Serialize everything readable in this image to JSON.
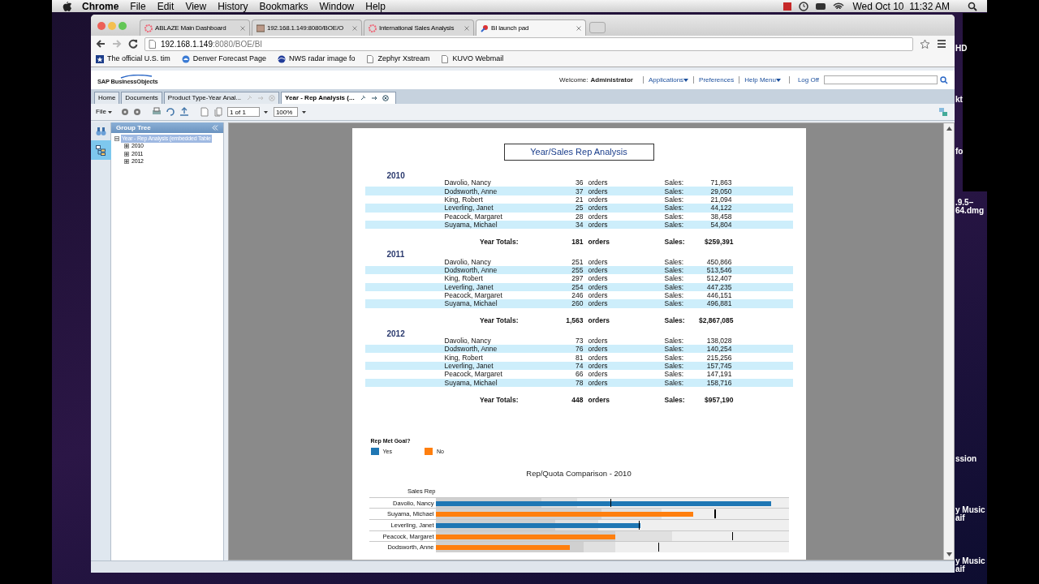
{
  "menu_bar": {
    "app": "Chrome",
    "menus": [
      "File",
      "Edit",
      "View",
      "History",
      "Bookmarks",
      "Window",
      "Help"
    ],
    "clock": "Wed Oct 10  11:32 AM"
  },
  "desktop_labels": [
    "HD",
    "kt",
    "fo",
    ".9.5–",
    "64.dmg",
    "ssion",
    "y Music",
    "aif",
    "y Music",
    "aif"
  ],
  "browser": {
    "tabs": [
      {
        "title": "ABLAZE Main Dashboard",
        "selected": false
      },
      {
        "title": "192.168.1.149:8080/BOE/O",
        "selected": false
      },
      {
        "title": "International Sales Analysis",
        "selected": false
      },
      {
        "title": "BI launch pad",
        "selected": true
      }
    ],
    "url_host": "192.168.1.149",
    "url_path": ":8080/BOE/BI",
    "bookmarks": [
      "The official U.S. tim",
      "Denver Forecast Page",
      "NWS radar image fo",
      "Zephyr Xstream",
      "KUVO Webmail"
    ]
  },
  "app": {
    "logo": "SAP BusinessObjects",
    "welcome_label": "Welcome:",
    "user": "Administrator",
    "header_links": [
      {
        "label": "Applications",
        "dropdown": true
      },
      {
        "label": "Preferences",
        "dropdown": false
      },
      {
        "label": "Help Menu",
        "dropdown": true
      },
      {
        "label": "Log Off",
        "dropdown": false
      }
    ],
    "doc_tabs": [
      {
        "label": "Home",
        "selected": false
      },
      {
        "label": "Documents",
        "selected": false
      },
      {
        "label": "Product Type-Year Anal...",
        "selected": false
      },
      {
        "label": "Year - Rep Analysis (...",
        "selected": true
      }
    ],
    "toolbar": {
      "file_menu": "File",
      "page": "1 of 1",
      "zoom": "100%"
    },
    "group_tree": {
      "title": "Group Tree",
      "items": [
        {
          "label": "Year - Rep Analysis (embedded Table",
          "selected": true,
          "expanded": true,
          "children": [
            {
              "label": "2010",
              "selected": false,
              "expanded": false
            },
            {
              "label": "2011",
              "selected": false,
              "expanded": false
            },
            {
              "label": "2012",
              "selected": false,
              "expanded": false
            }
          ]
        }
      ]
    }
  },
  "report": {
    "title": "Year/Sales Rep Analysis",
    "years": [
      {
        "year": "2010",
        "rows": [
          {
            "rep": "Davolio, Nancy",
            "orders": "36",
            "unit": "orders",
            "sales_label": "Sales:",
            "sales": "71,863"
          },
          {
            "rep": "Dodsworth, Anne",
            "orders": "37",
            "unit": "orders",
            "sales_label": "Sales:",
            "sales": "29,050"
          },
          {
            "rep": "King, Robert",
            "orders": "21",
            "unit": "orders",
            "sales_label": "Sales:",
            "sales": "21,094"
          },
          {
            "rep": "Leverling, Janet",
            "orders": "25",
            "unit": "orders",
            "sales_label": "Sales:",
            "sales": "44,122"
          },
          {
            "rep": "Peacock, Margaret",
            "orders": "28",
            "unit": "orders",
            "sales_label": "Sales:",
            "sales": "38,458"
          },
          {
            "rep": "Suyama, Michael",
            "orders": "34",
            "unit": "orders",
            "sales_label": "Sales:",
            "sales": "54,804"
          }
        ],
        "totals": {
          "label": "Year Totals:",
          "orders": "181",
          "unit": "orders",
          "sales_label": "Sales:",
          "sales": "$259,391"
        }
      },
      {
        "year": "2011",
        "rows": [
          {
            "rep": "Davolio, Nancy",
            "orders": "251",
            "unit": "orders",
            "sales_label": "Sales:",
            "sales": "450,866"
          },
          {
            "rep": "Dodsworth, Anne",
            "orders": "255",
            "unit": "orders",
            "sales_label": "Sales:",
            "sales": "513,546"
          },
          {
            "rep": "King, Robert",
            "orders": "297",
            "unit": "orders",
            "sales_label": "Sales:",
            "sales": "512,407"
          },
          {
            "rep": "Leverling, Janet",
            "orders": "254",
            "unit": "orders",
            "sales_label": "Sales:",
            "sales": "447,235"
          },
          {
            "rep": "Peacock, Margaret",
            "orders": "246",
            "unit": "orders",
            "sales_label": "Sales:",
            "sales": "446,151"
          },
          {
            "rep": "Suyama, Michael",
            "orders": "260",
            "unit": "orders",
            "sales_label": "Sales:",
            "sales": "496,881"
          }
        ],
        "totals": {
          "label": "Year Totals:",
          "orders": "1,563",
          "unit": "orders",
          "sales_label": "Sales:",
          "sales": "$2,867,085"
        }
      },
      {
        "year": "2012",
        "rows": [
          {
            "rep": "Davolio, Nancy",
            "orders": "73",
            "unit": "orders",
            "sales_label": "Sales:",
            "sales": "138,028"
          },
          {
            "rep": "Dodsworth, Anne",
            "orders": "76",
            "unit": "orders",
            "sales_label": "Sales:",
            "sales": "140,254"
          },
          {
            "rep": "King, Robert",
            "orders": "81",
            "unit": "orders",
            "sales_label": "Sales:",
            "sales": "215,256"
          },
          {
            "rep": "Leverling, Janet",
            "orders": "74",
            "unit": "orders",
            "sales_label": "Sales:",
            "sales": "157,745"
          },
          {
            "rep": "Peacock, Margaret",
            "orders": "66",
            "unit": "orders",
            "sales_label": "Sales:",
            "sales": "147,191"
          },
          {
            "rep": "Suyama, Michael",
            "orders": "78",
            "unit": "orders",
            "sales_label": "Sales:",
            "sales": "158,716"
          }
        ],
        "totals": {
          "label": "Year Totals:",
          "orders": "448",
          "unit": "orders",
          "sales_label": "Sales:",
          "sales": "$957,190"
        }
      }
    ],
    "legend": {
      "title": "Rep Met Goal?",
      "items": [
        {
          "label": "Yes",
          "color": "#1f77b4"
        },
        {
          "label": "No",
          "color": "#ff7f0e"
        }
      ]
    },
    "chart": {
      "title": "Rep/Quota Comparison - 2010",
      "axis_label": "Sales Rep",
      "reps": [
        {
          "name": "Davolio, Nancy",
          "met_goal": true
        },
        {
          "name": "Suyama, Michael",
          "met_goal": false
        },
        {
          "name": "Leverling, Janet",
          "met_goal": true
        },
        {
          "name": "Peacock, Margaret",
          "met_goal": false
        },
        {
          "name": "Dodsworth, Anne",
          "met_goal": false
        }
      ]
    }
  }
}
